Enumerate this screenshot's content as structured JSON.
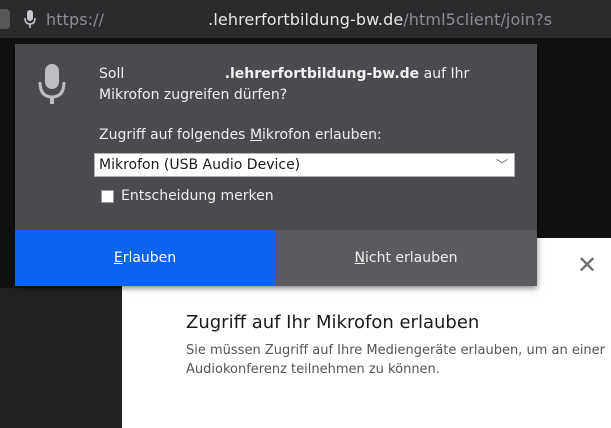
{
  "urlbar": {
    "icon": "microphone-icon",
    "scheme": "https://",
    "host": ".lehrerfortbildung-bw.de",
    "path": "/html5client/join?s"
  },
  "permission_popup": {
    "icon": "microphone-icon",
    "question_prefix": "Soll",
    "question_domain": ".lehrerfortbildung-bw.de",
    "question_suffix": "auf Ihr",
    "question_line2": "Mikrofon zugreifen dürfen?",
    "select_label_before": "Zugriff auf folgendes ",
    "select_label_accesskey": "M",
    "select_label_after": "ikrofon erlauben:",
    "selected_device": "Mikrofon (USB Audio Device)",
    "remember_label": "Entscheidung merken",
    "remember_checked": false,
    "allow_accesskey": "E",
    "allow_rest": "rlauben",
    "deny_accesskey": "N",
    "deny_rest": "icht erlauben",
    "colors": {
      "allow": "#0a64f0",
      "panel": "#4a4a4f"
    }
  },
  "dialog": {
    "title": "Zugriff auf Ihr Mikrofon erlauben",
    "message": "Sie müssen Zugriff auf Ihre Mediengeräte erlauben, um an einer Audiokonferenz teilnehmen zu können.",
    "close_icon": "close-icon"
  }
}
